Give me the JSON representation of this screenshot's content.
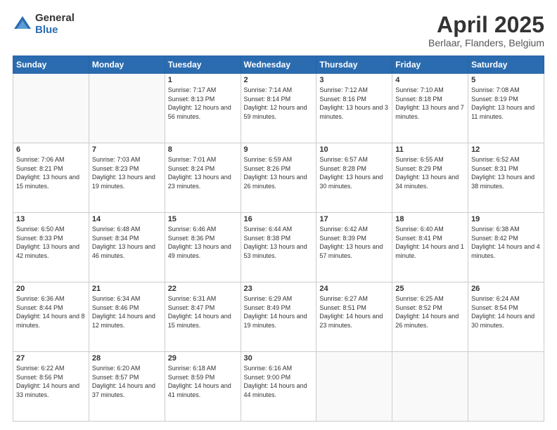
{
  "header": {
    "logo_general": "General",
    "logo_blue": "Blue",
    "title": "April 2025",
    "subtitle": "Berlaar, Flanders, Belgium"
  },
  "weekdays": [
    "Sunday",
    "Monday",
    "Tuesday",
    "Wednesday",
    "Thursday",
    "Friday",
    "Saturday"
  ],
  "weeks": [
    [
      {
        "day": "",
        "sunrise": "",
        "sunset": "",
        "daylight": ""
      },
      {
        "day": "",
        "sunrise": "",
        "sunset": "",
        "daylight": ""
      },
      {
        "day": "1",
        "sunrise": "Sunrise: 7:17 AM",
        "sunset": "Sunset: 8:13 PM",
        "daylight": "Daylight: 12 hours and 56 minutes."
      },
      {
        "day": "2",
        "sunrise": "Sunrise: 7:14 AM",
        "sunset": "Sunset: 8:14 PM",
        "daylight": "Daylight: 12 hours and 59 minutes."
      },
      {
        "day": "3",
        "sunrise": "Sunrise: 7:12 AM",
        "sunset": "Sunset: 8:16 PM",
        "daylight": "Daylight: 13 hours and 3 minutes."
      },
      {
        "day": "4",
        "sunrise": "Sunrise: 7:10 AM",
        "sunset": "Sunset: 8:18 PM",
        "daylight": "Daylight: 13 hours and 7 minutes."
      },
      {
        "day": "5",
        "sunrise": "Sunrise: 7:08 AM",
        "sunset": "Sunset: 8:19 PM",
        "daylight": "Daylight: 13 hours and 11 minutes."
      }
    ],
    [
      {
        "day": "6",
        "sunrise": "Sunrise: 7:06 AM",
        "sunset": "Sunset: 8:21 PM",
        "daylight": "Daylight: 13 hours and 15 minutes."
      },
      {
        "day": "7",
        "sunrise": "Sunrise: 7:03 AM",
        "sunset": "Sunset: 8:23 PM",
        "daylight": "Daylight: 13 hours and 19 minutes."
      },
      {
        "day": "8",
        "sunrise": "Sunrise: 7:01 AM",
        "sunset": "Sunset: 8:24 PM",
        "daylight": "Daylight: 13 hours and 23 minutes."
      },
      {
        "day": "9",
        "sunrise": "Sunrise: 6:59 AM",
        "sunset": "Sunset: 8:26 PM",
        "daylight": "Daylight: 13 hours and 26 minutes."
      },
      {
        "day": "10",
        "sunrise": "Sunrise: 6:57 AM",
        "sunset": "Sunset: 8:28 PM",
        "daylight": "Daylight: 13 hours and 30 minutes."
      },
      {
        "day": "11",
        "sunrise": "Sunrise: 6:55 AM",
        "sunset": "Sunset: 8:29 PM",
        "daylight": "Daylight: 13 hours and 34 minutes."
      },
      {
        "day": "12",
        "sunrise": "Sunrise: 6:52 AM",
        "sunset": "Sunset: 8:31 PM",
        "daylight": "Daylight: 13 hours and 38 minutes."
      }
    ],
    [
      {
        "day": "13",
        "sunrise": "Sunrise: 6:50 AM",
        "sunset": "Sunset: 8:33 PM",
        "daylight": "Daylight: 13 hours and 42 minutes."
      },
      {
        "day": "14",
        "sunrise": "Sunrise: 6:48 AM",
        "sunset": "Sunset: 8:34 PM",
        "daylight": "Daylight: 13 hours and 46 minutes."
      },
      {
        "day": "15",
        "sunrise": "Sunrise: 6:46 AM",
        "sunset": "Sunset: 8:36 PM",
        "daylight": "Daylight: 13 hours and 49 minutes."
      },
      {
        "day": "16",
        "sunrise": "Sunrise: 6:44 AM",
        "sunset": "Sunset: 8:38 PM",
        "daylight": "Daylight: 13 hours and 53 minutes."
      },
      {
        "day": "17",
        "sunrise": "Sunrise: 6:42 AM",
        "sunset": "Sunset: 8:39 PM",
        "daylight": "Daylight: 13 hours and 57 minutes."
      },
      {
        "day": "18",
        "sunrise": "Sunrise: 6:40 AM",
        "sunset": "Sunset: 8:41 PM",
        "daylight": "Daylight: 14 hours and 1 minute."
      },
      {
        "day": "19",
        "sunrise": "Sunrise: 6:38 AM",
        "sunset": "Sunset: 8:42 PM",
        "daylight": "Daylight: 14 hours and 4 minutes."
      }
    ],
    [
      {
        "day": "20",
        "sunrise": "Sunrise: 6:36 AM",
        "sunset": "Sunset: 8:44 PM",
        "daylight": "Daylight: 14 hours and 8 minutes."
      },
      {
        "day": "21",
        "sunrise": "Sunrise: 6:34 AM",
        "sunset": "Sunset: 8:46 PM",
        "daylight": "Daylight: 14 hours and 12 minutes."
      },
      {
        "day": "22",
        "sunrise": "Sunrise: 6:31 AM",
        "sunset": "Sunset: 8:47 PM",
        "daylight": "Daylight: 14 hours and 15 minutes."
      },
      {
        "day": "23",
        "sunrise": "Sunrise: 6:29 AM",
        "sunset": "Sunset: 8:49 PM",
        "daylight": "Daylight: 14 hours and 19 minutes."
      },
      {
        "day": "24",
        "sunrise": "Sunrise: 6:27 AM",
        "sunset": "Sunset: 8:51 PM",
        "daylight": "Daylight: 14 hours and 23 minutes."
      },
      {
        "day": "25",
        "sunrise": "Sunrise: 6:25 AM",
        "sunset": "Sunset: 8:52 PM",
        "daylight": "Daylight: 14 hours and 26 minutes."
      },
      {
        "day": "26",
        "sunrise": "Sunrise: 6:24 AM",
        "sunset": "Sunset: 8:54 PM",
        "daylight": "Daylight: 14 hours and 30 minutes."
      }
    ],
    [
      {
        "day": "27",
        "sunrise": "Sunrise: 6:22 AM",
        "sunset": "Sunset: 8:56 PM",
        "daylight": "Daylight: 14 hours and 33 minutes."
      },
      {
        "day": "28",
        "sunrise": "Sunrise: 6:20 AM",
        "sunset": "Sunset: 8:57 PM",
        "daylight": "Daylight: 14 hours and 37 minutes."
      },
      {
        "day": "29",
        "sunrise": "Sunrise: 6:18 AM",
        "sunset": "Sunset: 8:59 PM",
        "daylight": "Daylight: 14 hours and 41 minutes."
      },
      {
        "day": "30",
        "sunrise": "Sunrise: 6:16 AM",
        "sunset": "Sunset: 9:00 PM",
        "daylight": "Daylight: 14 hours and 44 minutes."
      },
      {
        "day": "",
        "sunrise": "",
        "sunset": "",
        "daylight": ""
      },
      {
        "day": "",
        "sunrise": "",
        "sunset": "",
        "daylight": ""
      },
      {
        "day": "",
        "sunrise": "",
        "sunset": "",
        "daylight": ""
      }
    ]
  ]
}
